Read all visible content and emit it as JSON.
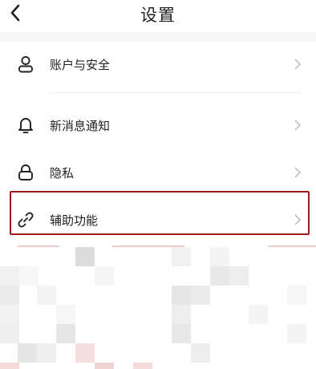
{
  "header": {
    "title": "设置",
    "back_icon": "chevron-left-icon"
  },
  "settings": {
    "items": [
      {
        "id": "account-security",
        "label": "账户与安全",
        "icon": "person-icon"
      },
      {
        "id": "notifications",
        "label": "新消息通知",
        "icon": "bell-icon"
      },
      {
        "id": "privacy",
        "label": "隐私",
        "icon": "lock-icon"
      },
      {
        "id": "accessibility",
        "label": "辅助功能",
        "icon": "link-icon",
        "highlighted": true
      }
    ]
  },
  "colors": {
    "highlight_border": "#9e1b1f",
    "section_gap": "#f6f6f6"
  }
}
